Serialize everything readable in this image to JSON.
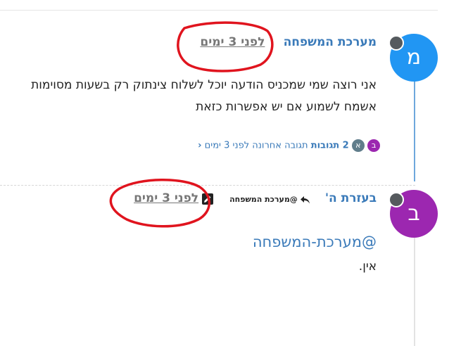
{
  "post1": {
    "avatar_letter": "מ",
    "author": "מערכת המשפחה",
    "timestamp": "לפני 3 ימים",
    "body_line1": "אני רוצה שמי שמכניס הודעה יוכל לשלוח צינתוק רק בשעות מסוימות",
    "body_line2": "אשמח לשמוע אם יש אפשרות כזאת",
    "replies": {
      "avatars": [
        {
          "letter": "ב",
          "color": "#9c27b0"
        },
        {
          "letter": "א",
          "color": "#607d8b"
        }
      ],
      "count_label": "2 תגובות",
      "last_reply_label": "תגובה אחרונה לפני 3 ימים",
      "chevron": "‹"
    }
  },
  "post2": {
    "avatar_letter": "ב",
    "author": "בעזרת ה'",
    "reply_to": "@מערכת המשפחה",
    "timestamp": "לפני 3 ימים",
    "mention": "@מערכת-המשפחה",
    "body": "אין."
  },
  "colors": {
    "accent": "#3a7ab9",
    "avatar_blue": "#2196f3",
    "avatar_purple": "#9c27b0",
    "annotation_red": "#e0141e"
  },
  "icons": {
    "reply": "reply-arrow-icon",
    "edit": "pencil-icon",
    "status": "status-dot-icon"
  }
}
